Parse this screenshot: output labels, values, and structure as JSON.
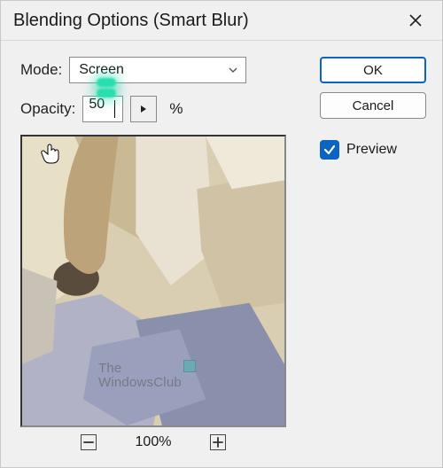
{
  "dialog": {
    "title": "Blending Options (Smart Blur)"
  },
  "mode": {
    "label": "Mode:",
    "value": "Screen"
  },
  "opacity": {
    "label": "Opacity:",
    "value": "50",
    "unit": "%"
  },
  "zoom": {
    "level": "100%"
  },
  "buttons": {
    "ok": "OK",
    "cancel": "Cancel"
  },
  "preview": {
    "label": "Preview",
    "checked": true
  },
  "watermark": {
    "line1": "The",
    "line2": "WindowsClub"
  },
  "icons": {
    "close": "close-icon",
    "chevron": "chevron-down-icon",
    "play": "triangle-right-icon",
    "minus": "minus-icon",
    "plus": "plus-icon",
    "check": "check-icon",
    "hand": "hand-cursor-icon"
  }
}
